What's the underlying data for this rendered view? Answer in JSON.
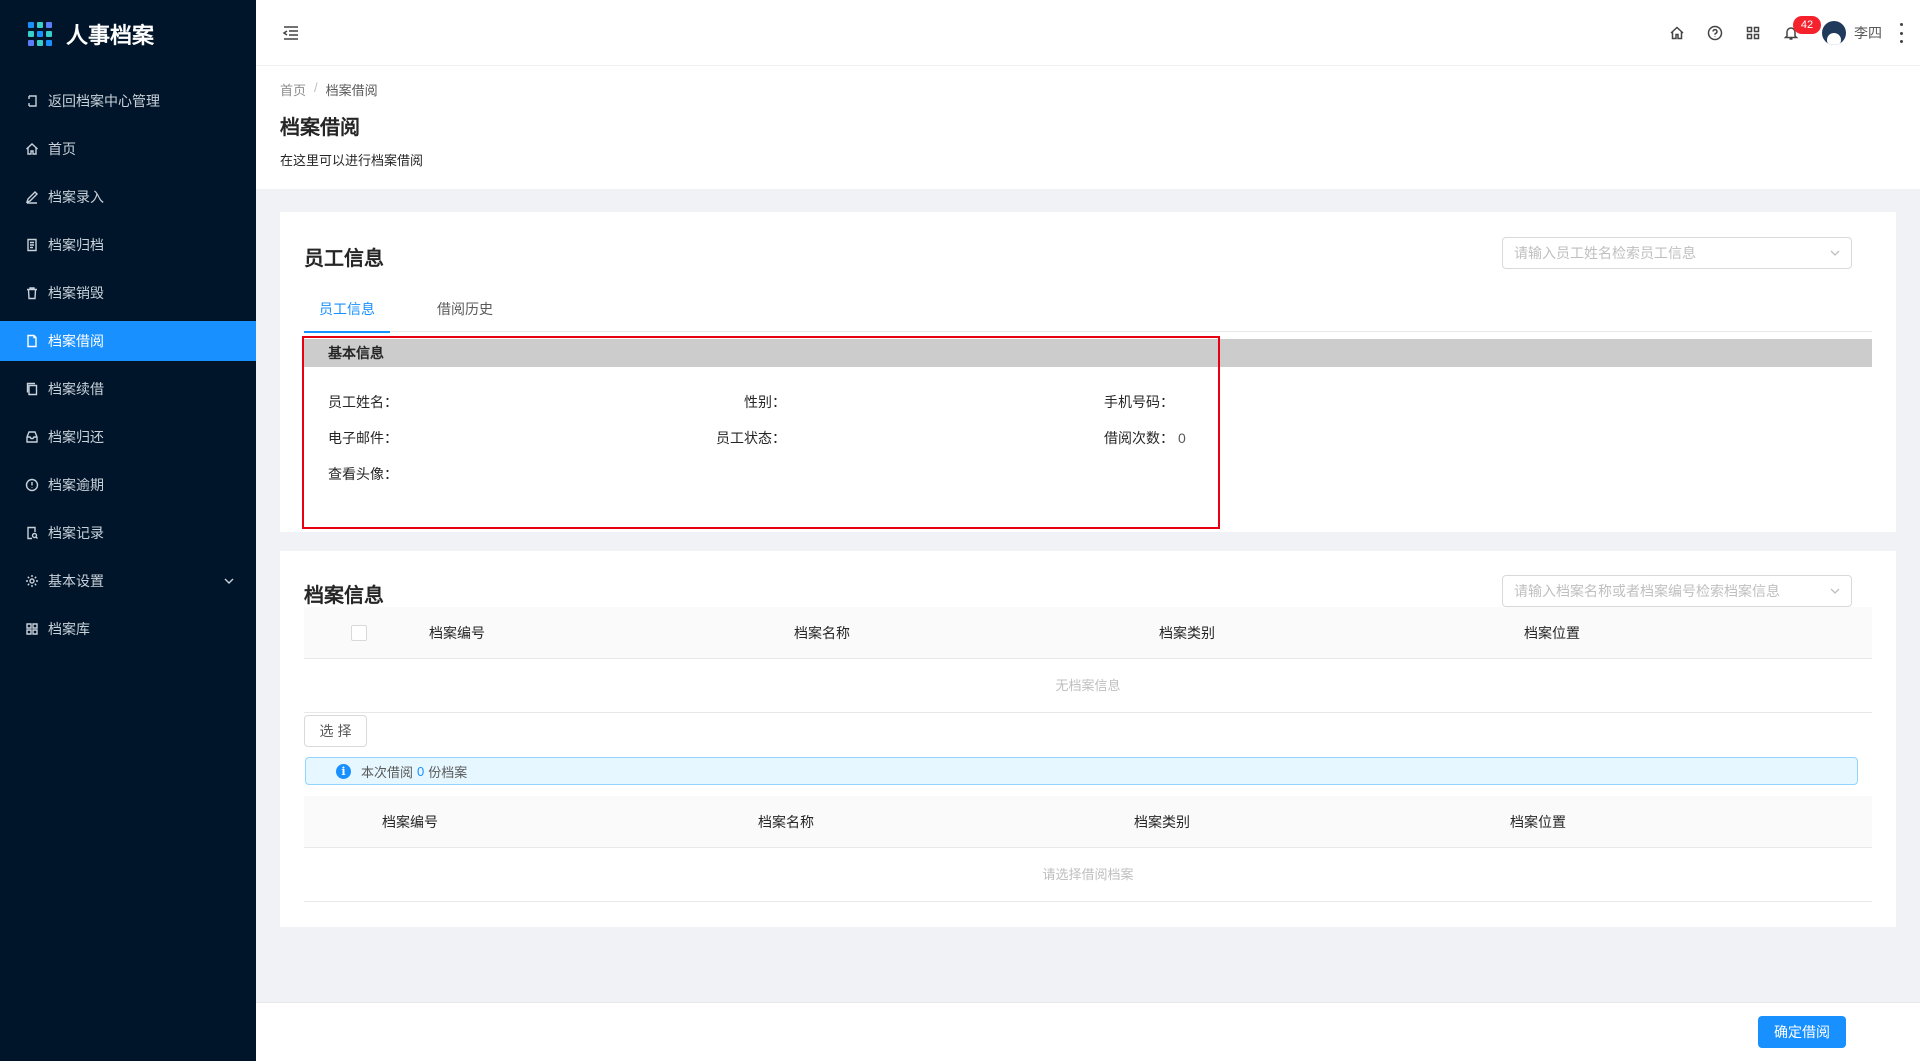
{
  "app": {
    "title": "人事档案"
  },
  "sidebar": {
    "items": [
      {
        "label": "返回档案中心管理",
        "icon": "return-icon"
      },
      {
        "label": "首页",
        "icon": "home-icon"
      },
      {
        "label": "档案录入",
        "icon": "edit-icon"
      },
      {
        "label": "档案归档",
        "icon": "file-text-icon"
      },
      {
        "label": "档案销毁",
        "icon": "trash-icon"
      },
      {
        "label": "档案借阅",
        "icon": "file-icon",
        "active": true
      },
      {
        "label": "档案续借",
        "icon": "copy-icon"
      },
      {
        "label": "档案归还",
        "icon": "inbox-icon"
      },
      {
        "label": "档案逾期",
        "icon": "alert-circle-icon"
      },
      {
        "label": "档案记录",
        "icon": "file-search-icon"
      },
      {
        "label": "基本设置",
        "icon": "gear-icon",
        "has_children": true
      },
      {
        "label": "档案库",
        "icon": "grid-icon"
      }
    ]
  },
  "header": {
    "notification_count": "42",
    "user_name": "李四"
  },
  "page": {
    "breadcrumb": [
      "首页",
      "档案借阅"
    ],
    "title": "档案借阅",
    "description": "在这里可以进行档案借阅"
  },
  "employee": {
    "title": "员工信息",
    "search_placeholder": "请输入员工姓名检索员工信息",
    "tabs": [
      "员工信息",
      "借阅历史"
    ],
    "section_title": "基本信息",
    "fields": {
      "name_label": "员工姓名：",
      "name_value": "",
      "gender_label": "性别：",
      "gender_value": "",
      "phone_label": "手机号码：",
      "phone_value": "",
      "email_label": "电子邮件：",
      "email_value": "",
      "status_label": "员工状态：",
      "status_value": "",
      "borrow_count_label": "借阅次数：",
      "borrow_count_value": "0",
      "avatar_label": "查看头像："
    }
  },
  "archive": {
    "title": "档案信息",
    "search_placeholder": "请输入档案名称或者档案编号检索档案信息",
    "columns": [
      "档案编号",
      "档案名称",
      "档案类别",
      "档案位置"
    ],
    "empty_text": "无档案信息",
    "select_button": "选择",
    "alert_prefix": "本次借阅",
    "alert_count": "0",
    "alert_suffix": "份档案",
    "selected_columns": [
      "档案编号",
      "档案名称",
      "档案类别",
      "档案位置"
    ],
    "selected_empty_text": "请选择借阅档案"
  },
  "footer": {
    "confirm_button": "确定借阅"
  },
  "colors": {
    "sidebar_bg": "#001529",
    "primary": "#1890ff",
    "highlight": "#e60012",
    "badge": "#f5222d"
  }
}
